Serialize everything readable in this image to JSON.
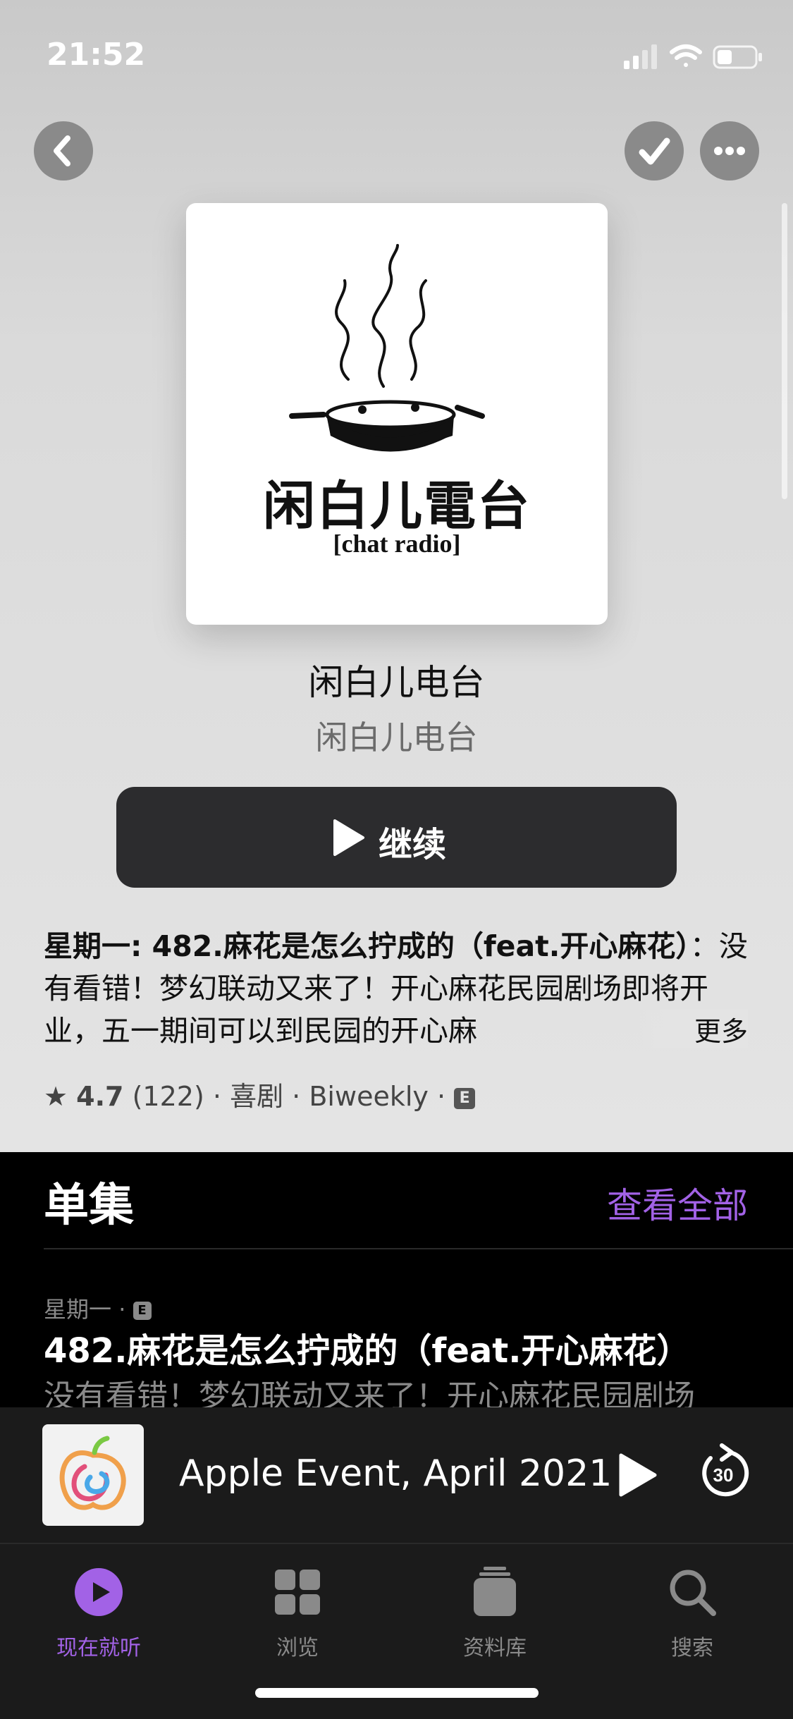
{
  "status": {
    "time": "21:52"
  },
  "artwork": {
    "title": "闲白儿電台",
    "subtitle": "[chat  radio]"
  },
  "show": {
    "title": "闲白儿电台",
    "author": "闲白儿电台"
  },
  "resume_button": {
    "label": "继续"
  },
  "description": {
    "prefix": "星期一: 482.麻花是怎么拧成的（feat.开心麻花）",
    "body": "：没有看错！梦幻联动又来了！开心麻花民园剧场即将开业，五一期间可以到民园的开心麻",
    "more_label": "更多"
  },
  "meta": {
    "rating": "4.7",
    "rating_count": "(122)",
    "separator": "·",
    "genre": "喜剧",
    "frequency": "Biweekly",
    "explicit_badge": "E"
  },
  "episodes": {
    "section_title": "单集",
    "see_all_label": "查看全部",
    "items": [
      {
        "day": "星期一",
        "separator": "·",
        "explicit_badge": "E",
        "title": "482.麻花是怎么拧成的（feat.开心麻花）",
        "description": "没有看错！梦幻联动又来了！开心麻花民园剧场"
      }
    ]
  },
  "mini_player": {
    "title": "Apple Event, April 2021",
    "skip_label": "30"
  },
  "tabbar": {
    "tabs": [
      {
        "label": "现在就听",
        "icon": "play-circle-icon",
        "active": true
      },
      {
        "label": "浏览",
        "icon": "grid-icon",
        "active": false
      },
      {
        "label": "资料库",
        "icon": "library-icon",
        "active": false
      },
      {
        "label": "搜索",
        "icon": "search-icon",
        "active": false
      }
    ]
  },
  "colors": {
    "accent": "#a262e6",
    "button_dark": "#2c2c2e",
    "background_dark": "#000000"
  }
}
